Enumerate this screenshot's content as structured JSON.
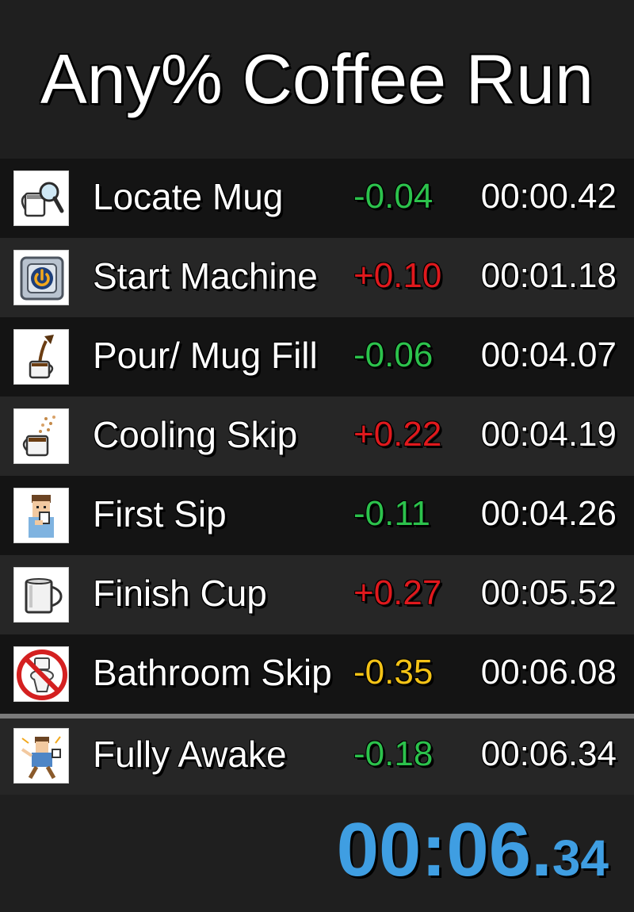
{
  "title": "Any% Coffee Run",
  "colors": {
    "ahead": "#2cc24c",
    "behind": "#e0191d",
    "gold": "#f4c316",
    "timer": "#3f9ee2"
  },
  "splits": [
    {
      "icon": "mug-search-icon",
      "name": "Locate Mug",
      "delta": "-0.04",
      "status": "ahead",
      "time": "00:00.42"
    },
    {
      "icon": "power-button-icon",
      "name": "Start Machine",
      "delta": "+0.10",
      "status": "behind",
      "time": "00:01.18"
    },
    {
      "icon": "pouring-coffee-icon",
      "name": "Pour/ Mug Fill",
      "delta": "-0.06",
      "status": "ahead",
      "time": "00:04.07"
    },
    {
      "icon": "steaming-mug-icon",
      "name": "Cooling Skip",
      "delta": "+0.22",
      "status": "behind",
      "time": "00:04.19"
    },
    {
      "icon": "person-sipping-icon",
      "name": "First Sip",
      "delta": "-0.11",
      "status": "ahead",
      "time": "00:04.26"
    },
    {
      "icon": "empty-cup-icon",
      "name": "Finish Cup",
      "delta": "+0.27",
      "status": "behind",
      "time": "00:05.52"
    },
    {
      "icon": "no-toilet-icon",
      "name": "Bathroom Skip",
      "delta": "-0.35",
      "status": "gold",
      "time": "00:06.08"
    },
    {
      "icon": "energized-person-icon",
      "name": "Fully Awake",
      "delta": "-0.18",
      "status": "ahead",
      "time": "00:06.34"
    }
  ],
  "timer": {
    "main": "00:06.",
    "fraction": "34"
  }
}
